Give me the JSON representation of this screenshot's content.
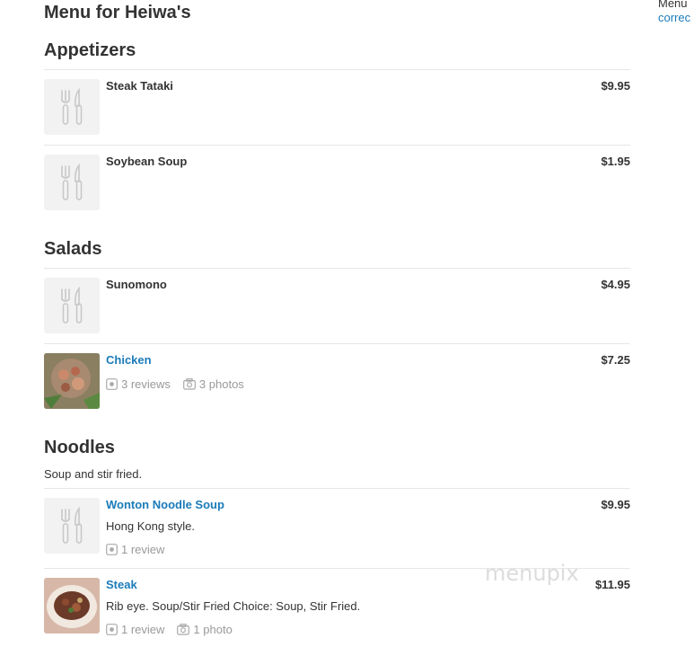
{
  "page_title": "Menu for Heiwa's",
  "sections": [
    {
      "title": "Appetizers",
      "items": [
        {
          "name": "Steak Tataki",
          "price": "$9.95"
        },
        {
          "name": "Soybean Soup",
          "price": "$1.95"
        }
      ]
    },
    {
      "title": "Salads",
      "items": [
        {
          "name": "Sunomono",
          "price": "$4.95"
        },
        {
          "name": "Chicken",
          "price": "$7.25",
          "reviews": "3 reviews",
          "photos": "3 photos"
        }
      ]
    },
    {
      "title": "Noodles",
      "description": "Soup and stir fried.",
      "items": [
        {
          "name": "Wonton Noodle Soup",
          "price": "$9.95",
          "description": "Hong Kong style.",
          "reviews": "1 review"
        },
        {
          "name": "Steak",
          "price": "$11.95",
          "description": "Rib eye. Soup/Stir Fried Choice: Soup, Stir Fried.",
          "reviews": "1 review",
          "photos": "1 photo"
        }
      ]
    }
  ],
  "sidebar": {
    "text": "Menu",
    "link": "correc"
  },
  "watermark": "menupix",
  "colors": {
    "link": "#1a7bb9",
    "text": "#333333",
    "muted": "#999999",
    "placeholder_bg": "#f2f2f2"
  },
  "icons": {
    "placeholder": "fork-knife-icon",
    "review": "review-star-icon",
    "photo": "camera-icon"
  }
}
